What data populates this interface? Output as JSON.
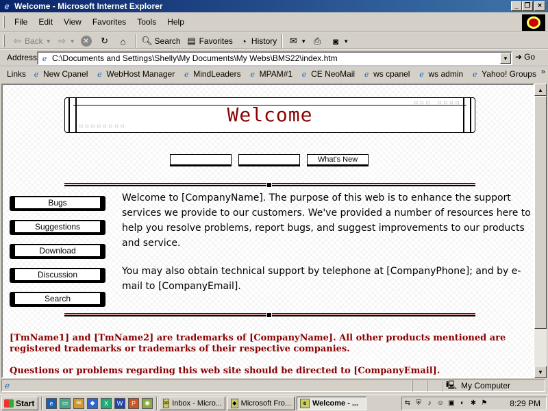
{
  "window": {
    "title": "Welcome - Microsoft Internet Explorer",
    "minimize": "_",
    "maximize": "❐",
    "close": "×"
  },
  "menu": [
    "File",
    "Edit",
    "View",
    "Favorites",
    "Tools",
    "Help"
  ],
  "toolbar": {
    "back": "Back",
    "search": "Search",
    "favorites": "Favorites",
    "history": "History"
  },
  "address": {
    "label": "Address",
    "value": "C:\\Documents and Settings\\Shelly\\My Documents\\My Webs\\BMS22\\index.htm",
    "go": "Go"
  },
  "links": {
    "label": "Links",
    "items": [
      "New Cpanel",
      "WebHost Manager",
      "MindLeaders",
      "MPAM#1",
      "CE NeoMail",
      "ws cpanel",
      "ws admin",
      "Yahoo! Groups"
    ]
  },
  "page": {
    "banner_title": "Welcome",
    "top_nav": [
      "",
      "",
      "What's New"
    ],
    "side_nav": [
      "Bugs",
      "Suggestions",
      "Download",
      "Discussion",
      "Search"
    ],
    "paragraph1": "Welcome to [CompanyName]. The purpose of this web is to enhance the support services we provide to our customers. We've provided a number of resources here to help you resolve problems, report bugs, and suggest improvements to our products and service.",
    "paragraph2": "You may also obtain technical support by telephone at [CompanyPhone]; and by e-mail to [CompanyEmail].",
    "trademark": "[TmName1] and [TmName2] are trademarks of [CompanyName]. All other products mentioned are registered trademarks or trademarks of their respective companies.",
    "contact": "Questions or problems regarding this web site should be directed to [CompanyEmail]."
  },
  "status": {
    "zone": "My Computer"
  },
  "taskbar": {
    "start": "Start",
    "tasks": [
      "Inbox - Micro...",
      "Microsoft Fro...",
      "Welcome - ..."
    ],
    "clock": "8:29 PM"
  }
}
